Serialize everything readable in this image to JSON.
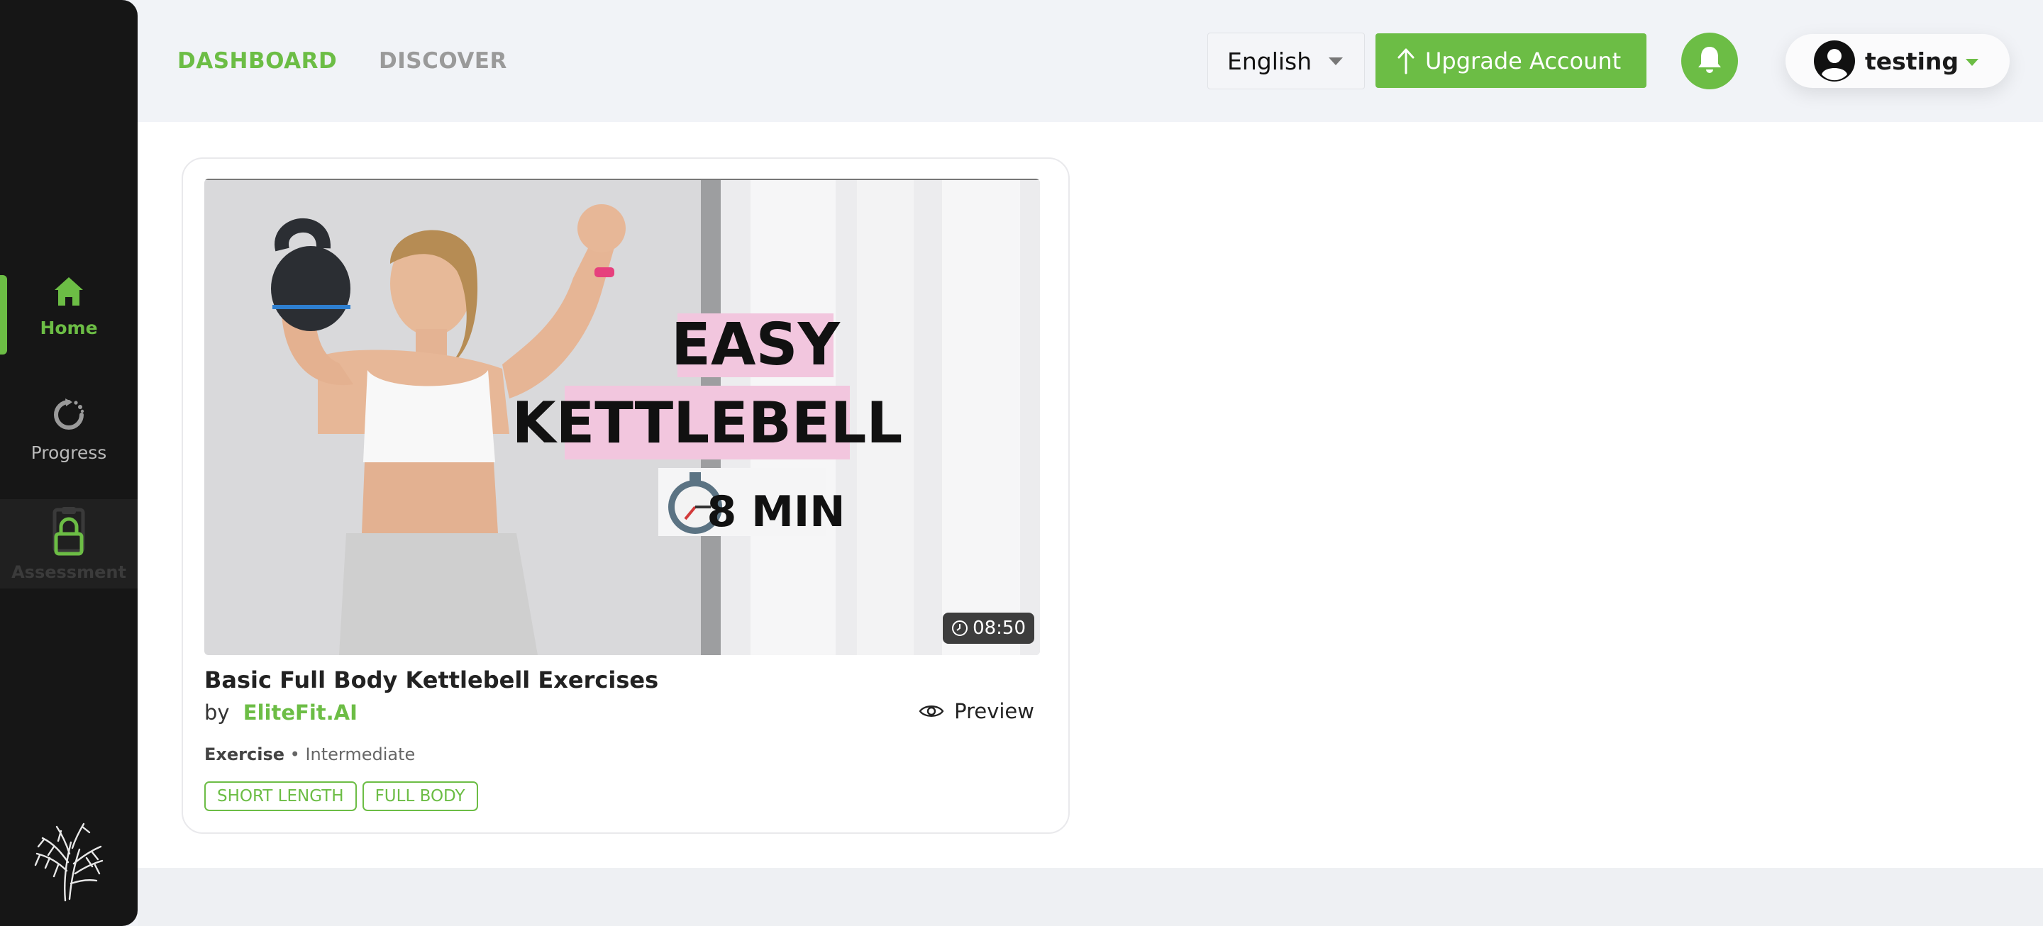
{
  "sidebar": {
    "items": [
      {
        "label": "Home",
        "icon": "home-icon",
        "active": true
      },
      {
        "label": "Progress",
        "icon": "progress-icon",
        "active": false
      },
      {
        "label": "Assessment",
        "icon": "clipboard-icon",
        "locked": true
      }
    ],
    "logo": "tree-logo"
  },
  "nav": {
    "dashboard": "DASHBOARD",
    "discover": "DISCOVER"
  },
  "language": {
    "selected": "English"
  },
  "upgrade": {
    "label": "Upgrade Account"
  },
  "user": {
    "name": "testing"
  },
  "workout_card": {
    "title": "Basic Full Body Kettlebell Exercises",
    "by_prefix": "by",
    "author": "EliteFit.AI",
    "preview_label": "Preview",
    "duration": "08:50",
    "category": "Exercise",
    "separator": " • ",
    "level": "Intermediate",
    "tags": [
      "SHORT LENGTH",
      "FULL BODY"
    ],
    "thumbnail": {
      "line1": "EASY",
      "line2": "KETTLEBELL",
      "line3": "8 MIN"
    }
  },
  "colors": {
    "accent": "#6cbd45",
    "sidebar": "#161616",
    "thumb_pink": "#f2c6de"
  }
}
